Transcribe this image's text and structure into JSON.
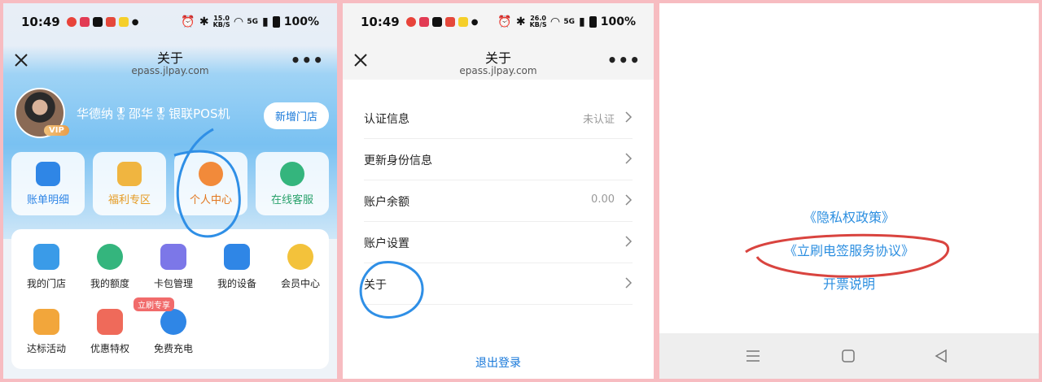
{
  "status_left": {
    "time": "10:49"
  },
  "status_right_p1": {
    "speed_top": "15.0",
    "speed_bottom": "KB/S",
    "net": "5G",
    "battery": "100%"
  },
  "status_right_p2": {
    "speed_top": "26.0",
    "speed_bottom": "KB/S",
    "net": "5G",
    "battery": "100%"
  },
  "header": {
    "title": "关于",
    "domain": "epass.jlpay.com"
  },
  "profile": {
    "name": "华德纳🎖邵华🎖银联POS机",
    "vip": "VIP",
    "add_store": "新增门店"
  },
  "quick_tiles": [
    {
      "label": "账单明细",
      "color": "#2f86e6"
    },
    {
      "label": "福利专区",
      "color": "#f0b540"
    },
    {
      "label": "个人中心",
      "color": "#f28a3a"
    },
    {
      "label": "在线客服",
      "color": "#34b57d"
    }
  ],
  "grid": [
    {
      "label": "我的门店",
      "color": "#3a9be8"
    },
    {
      "label": "我的额度",
      "color": "#34b57d"
    },
    {
      "label": "卡包管理",
      "color": "#7c77e8"
    },
    {
      "label": "我的设备",
      "color": "#2f86e6"
    },
    {
      "label": "会员中心",
      "color": "#f3c23b"
    },
    {
      "label": "达标活动",
      "color": "#f2a63b"
    },
    {
      "label": "优惠特权",
      "color": "#ef6a5a"
    },
    {
      "label": "免费充电",
      "color": "#2f86e6"
    }
  ],
  "promo_tag": "立刷专享",
  "menu": [
    {
      "label": "认证信息",
      "value": "未认证"
    },
    {
      "label": "更新身份信息",
      "value": ""
    },
    {
      "label": "账户余额",
      "value": "0.00"
    },
    {
      "label": "账户设置",
      "value": ""
    },
    {
      "label": "关于",
      "value": ""
    }
  ],
  "logout": "退出登录",
  "links": [
    "《隐私权政策》",
    "《立刷电签服务协议》",
    "开票说明"
  ],
  "colors": {
    "accent": "#1677d9",
    "link": "#2d8fe0",
    "annotation_blue": "#2f8fe6",
    "annotation_red": "#d9443f"
  }
}
